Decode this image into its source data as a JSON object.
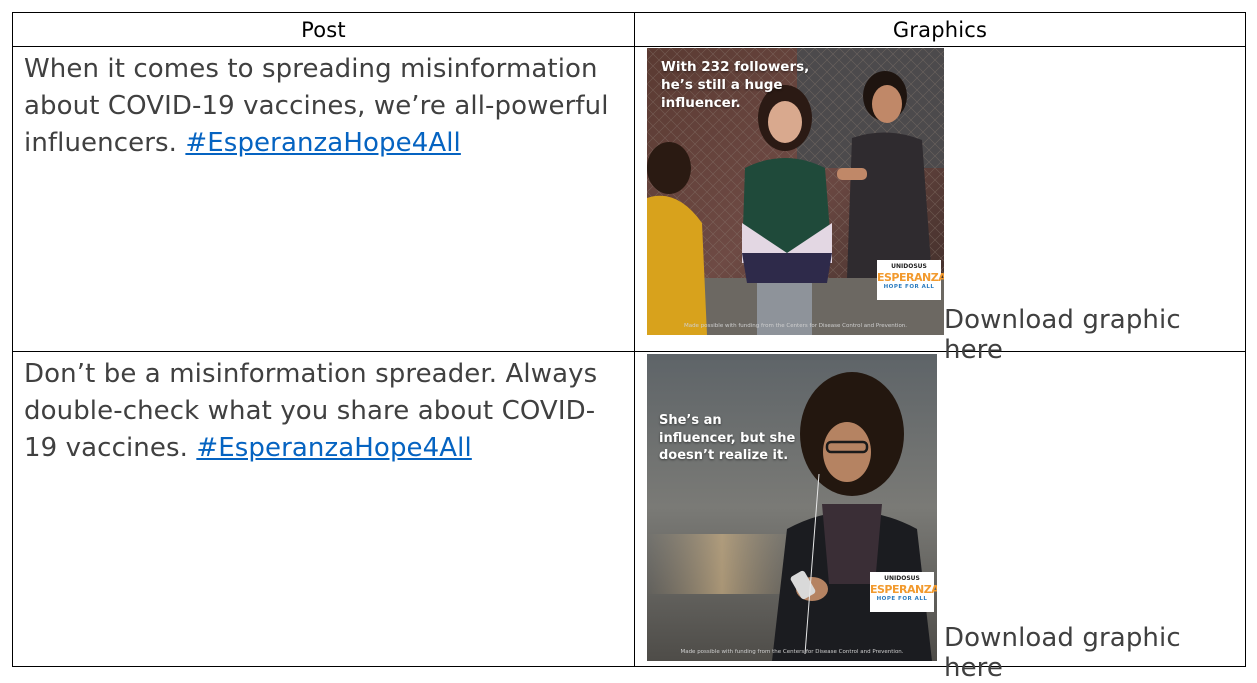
{
  "table": {
    "headers": [
      "Post",
      "Graphics"
    ],
    "rows": [
      {
        "post_text": "When it comes to spreading misinformation about COVID-19 vaccines, we’re all-powerful influencers. ",
        "hashtag": "#EsperanzaHope4All",
        "graphic_text": "With 232 followers, he’s still a huge influencer.",
        "download_label": "Download graphic here"
      },
      {
        "post_text": "Don’t be a misinformation spreader. Always double-check what you share about COVID-19 vaccines. ",
        "hashtag": "#EsperanzaHope4All",
        "graphic_text": "She’s an influencer, but she doesn’t realize it.",
        "download_label": "Download graphic here"
      }
    ]
  },
  "logo": {
    "line1": "UNIDOSUS",
    "line2": "ESPERANZA",
    "line3": "HOPE FOR ALL"
  },
  "credit_text": "Made possible with funding from the Centers for Disease Control and Prevention.",
  "colors": {
    "link": "#0563c1",
    "text": "#404040",
    "logo_orange": "#f29a2e",
    "logo_blue": "#2a7bbf"
  }
}
